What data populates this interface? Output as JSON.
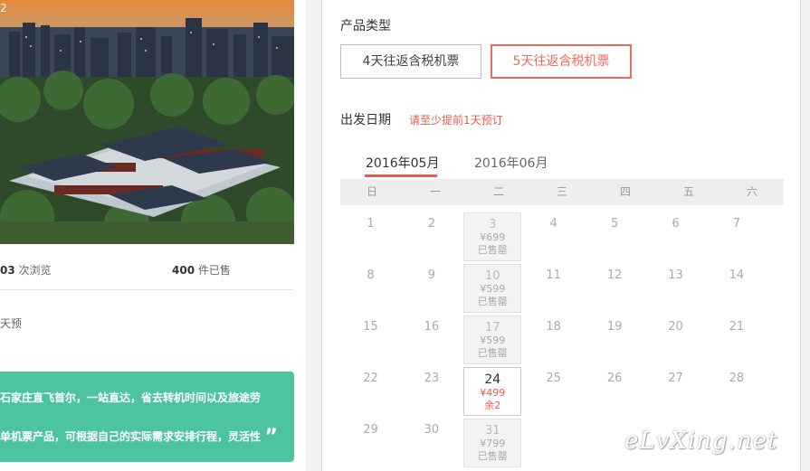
{
  "gallery": {
    "index_label": "2"
  },
  "stats": {
    "views": "03",
    "views_suffix": " 次浏览",
    "sold": "400",
    "sold_suffix": " 件已售"
  },
  "advance_note": "天预",
  "description": {
    "line1": "石家庄直飞首尔，一站直达，省去转机时间以及旅途劳",
    "line2": "单机票产品，可根据自己的实际需求安排行程，灵活性",
    "quote_mark": "”"
  },
  "product_type": {
    "title": "产品类型",
    "options": [
      {
        "label": "4天往返含税机票",
        "selected": false
      },
      {
        "label": "5天往返含税机票",
        "selected": true
      }
    ]
  },
  "departure": {
    "title": "出发日期",
    "hint": "请至少提前1天预订"
  },
  "calendar": {
    "tabs": [
      {
        "label": "2016年05月",
        "active": true
      },
      {
        "label": "2016年06月",
        "active": false
      }
    ],
    "weekdays": [
      "日",
      "一",
      "二",
      "三",
      "四",
      "五",
      "六"
    ],
    "rows": [
      [
        {
          "d": "1"
        },
        {
          "d": "2"
        },
        {
          "d": "3",
          "price": "¥699",
          "status": "已售罄"
        },
        {
          "d": "4"
        },
        {
          "d": "5"
        },
        {
          "d": "6"
        },
        {
          "d": "7"
        }
      ],
      [
        {
          "d": "8"
        },
        {
          "d": "9"
        },
        {
          "d": "10",
          "price": "¥599",
          "status": "已售罄"
        },
        {
          "d": "11"
        },
        {
          "d": "12"
        },
        {
          "d": "13"
        },
        {
          "d": "14"
        }
      ],
      [
        {
          "d": "15"
        },
        {
          "d": "16"
        },
        {
          "d": "17",
          "price": "¥599",
          "status": "已售罄"
        },
        {
          "d": "18"
        },
        {
          "d": "19"
        },
        {
          "d": "20"
        },
        {
          "d": "21"
        }
      ],
      [
        {
          "d": "22"
        },
        {
          "d": "23"
        },
        {
          "d": "24",
          "price": "¥499",
          "status": "余2",
          "available": true
        },
        {
          "d": "25"
        },
        {
          "d": "26"
        },
        {
          "d": "27"
        },
        {
          "d": "28"
        }
      ],
      [
        {
          "d": "29"
        },
        {
          "d": "30"
        },
        {
          "d": "31",
          "price": "¥799",
          "status": "已售罄"
        }
      ]
    ]
  },
  "watermark": "eLvXing.net",
  "colors": {
    "accent": "#e8594a",
    "green": "#4dc4a1"
  }
}
